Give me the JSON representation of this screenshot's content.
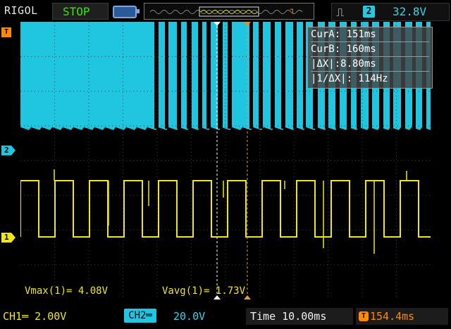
{
  "top_bar": {
    "brand": "RIGOL",
    "run_state": "STOP",
    "trigger": {
      "edge_icon": "rising-edge-icon",
      "source": "2",
      "level": "32.8V"
    }
  },
  "display": {
    "ch2_marker": "2",
    "ch1_marker": "1",
    "trigger_position_marker": "T",
    "colors": {
      "ch1": "#f0e61a",
      "ch2": "#20c6e0",
      "cursor_a": "#ffffff",
      "cursor_b": "#e0a030",
      "trigger": "#ff8a00"
    }
  },
  "cursor_panel": {
    "rows": [
      "CurA: 151ms",
      "CurB: 160ms",
      "|ΔX|:8.80ms",
      "|1/ΔX|: 114Hz"
    ]
  },
  "measurements": {
    "vmax": "Vmax(1)= 4.08V",
    "vavg": "Vavg(1)= 1.73V"
  },
  "bottom_bar": {
    "ch1_scale": "CH1═ 2.00V",
    "ch2_label": "CH2═",
    "ch2_scale": "20.0V",
    "timebase": "Time 10.00ms",
    "trigger_offset_icon": "T",
    "trigger_offset": "154.4ms"
  }
}
